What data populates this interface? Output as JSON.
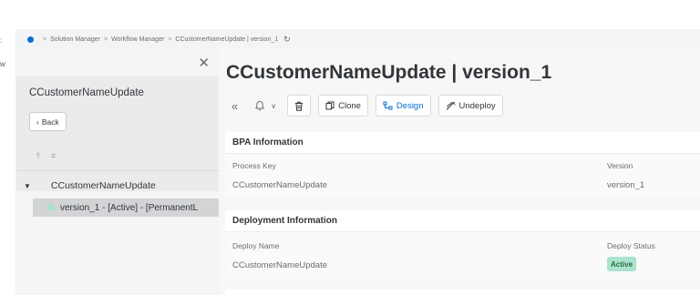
{
  "left_rail": {
    "glyph_top": ":",
    "glyph_mid": "w"
  },
  "breadcrumb": {
    "items": [
      "Solution Manager",
      "Workflow Manager",
      "CCustomerNameUpdate | version_1"
    ],
    "separator": ">"
  },
  "side_panel": {
    "title": "CCustomerNameUpdate",
    "back_label": "Back",
    "tree": {
      "root_label": "CCustomerNameUpdate",
      "child_label": "version_1 - [Active] - [PermanentL"
    }
  },
  "main": {
    "title": "CCustomerNameUpdate | version_1",
    "toolbar": {
      "collapse_glyph": "«",
      "clone_label": "Clone",
      "design_label": "Design",
      "undeploy_label": "Undeploy"
    },
    "bpa": {
      "heading": "BPA Information",
      "process_key_label": "Process Key",
      "process_key_value": "CCustomerNameUpdate",
      "version_label": "Version",
      "version_value": "version_1"
    },
    "deployment": {
      "heading": "Deployment Information",
      "deploy_name_label": "Deploy Name",
      "deploy_name_value": "CCustomerNameUpdate",
      "deploy_status_label": "Deploy Status",
      "deploy_status_value": "Active"
    }
  },
  "colors": {
    "accent": "#0a6ed1",
    "status_active_bg": "#abe2d0",
    "status_active_text": "#256f3a",
    "selected_row_bg": "#d3d4d6"
  }
}
